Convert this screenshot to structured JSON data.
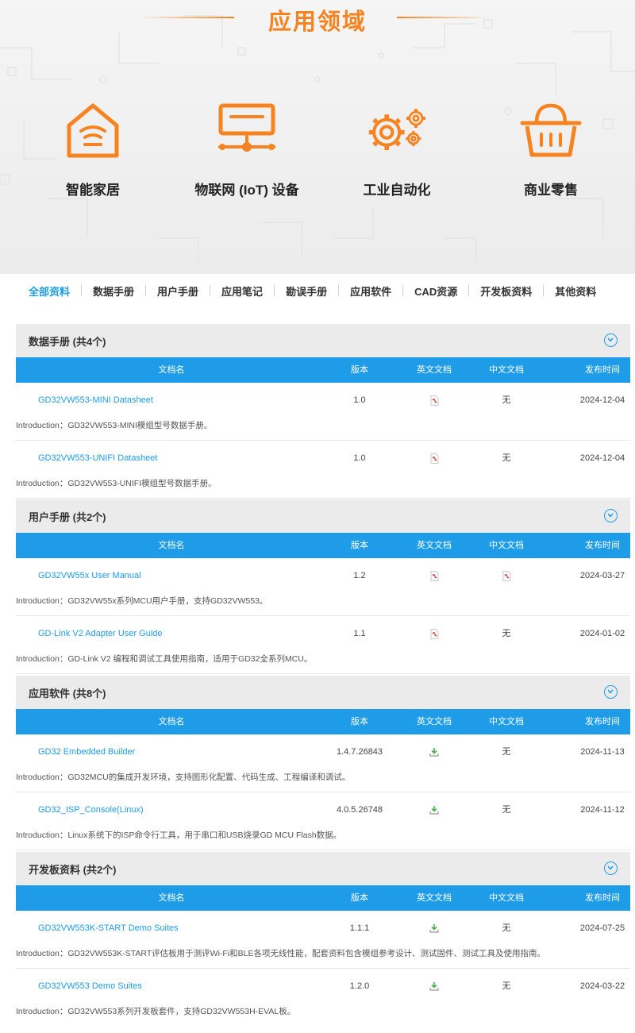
{
  "banner": {
    "title": "应用领域",
    "accent_color": "#f6831f",
    "items": [
      {
        "label": "智能家居",
        "icon": "smart-home-icon"
      },
      {
        "label": "物联网 (IoT) 设备",
        "icon": "iot-network-icon"
      },
      {
        "label": "工业自动化",
        "icon": "gears-icon"
      },
      {
        "label": "商业零售",
        "icon": "shopping-basket-icon"
      }
    ]
  },
  "tabs": [
    {
      "label": "全部资料",
      "active": true
    },
    {
      "label": "数据手册"
    },
    {
      "label": "用户手册"
    },
    {
      "label": "应用笔记"
    },
    {
      "label": "勘误手册"
    },
    {
      "label": "应用软件"
    },
    {
      "label": "CAD资源"
    },
    {
      "label": "开发板资料"
    },
    {
      "label": "其他资料"
    }
  ],
  "table_header_color": "#1e9ce8",
  "columns": {
    "name": "文档名",
    "version": "版本",
    "english": "英文文档",
    "chinese": "中文文档",
    "date": "发布时间"
  },
  "sections": [
    {
      "title": "数据手册 (共4个)",
      "rows": [
        {
          "name": "GD32VW553-MINI Datasheet",
          "version": "1.0",
          "english": "pdf-icon",
          "chinese": "无",
          "date": "2024-12-04",
          "intro": "Introduction：GD32VW553-MINI模组型号数据手册。"
        },
        {
          "name": "GD32VW553-UNIFI Datasheet",
          "version": "1.0",
          "english": "pdf-icon",
          "chinese": "无",
          "date": "2024-12-04",
          "intro": "Introduction：GD32VW553-UNIFI模组型号数据手册。"
        }
      ]
    },
    {
      "title": "用户手册 (共2个)",
      "rows": [
        {
          "name": "GD32VW55x User Manual",
          "version": "1.2",
          "english": "pdf-icon",
          "chinese": "pdf-icon",
          "date": "2024-03-27",
          "intro": "Introduction：GD32VW55x系列MCU用户手册，支持GD32VW553。"
        },
        {
          "name": "GD-Link V2 Adapter User Guide",
          "version": "1.1",
          "english": "pdf-icon",
          "chinese": "无",
          "date": "2024-01-02",
          "intro": "Introduction：GD-Link V2 编程和调试工具使用指南，适用于GD32全系列MCU。"
        }
      ]
    },
    {
      "title": "应用软件 (共8个)",
      "rows": [
        {
          "name": "GD32 Embedded Builder",
          "version": "1.4.7.26843",
          "english": "download-icon",
          "chinese": "无",
          "date": "2024-11-13",
          "intro": "Introduction：GD32MCU的集成开发环境，支持图形化配置、代码生成、工程编译和调试。"
        },
        {
          "name": "GD32_ISP_Console(Linux)",
          "version": "4.0.5.26748",
          "english": "download-icon",
          "chinese": "无",
          "date": "2024-11-12",
          "intro": "Introduction：Linux系统下的ISP命令行工具，用于串口和USB烧录GD MCU Flash数据。"
        }
      ]
    },
    {
      "title": "开发板资料 (共2个)",
      "rows": [
        {
          "name": "GD32VW553K-START Demo Suites",
          "version": "1.1.1",
          "english": "download-icon",
          "chinese": "无",
          "date": "2024-07-25",
          "intro": "Introduction：GD32VW553K-START评估板用于测评Wi-Fi和BLE各项无线性能，配套资料包含模组参考设计、测试固件、测试工具及使用指南。"
        },
        {
          "name": "GD32VW553 Demo Suites",
          "version": "1.2.0",
          "english": "download-icon",
          "chinese": "无",
          "date": "2024-03-22",
          "intro": "Introduction：GD32VW553系列开发板套件，支持GD32VW553H-EVAL板。"
        }
      ]
    }
  ]
}
